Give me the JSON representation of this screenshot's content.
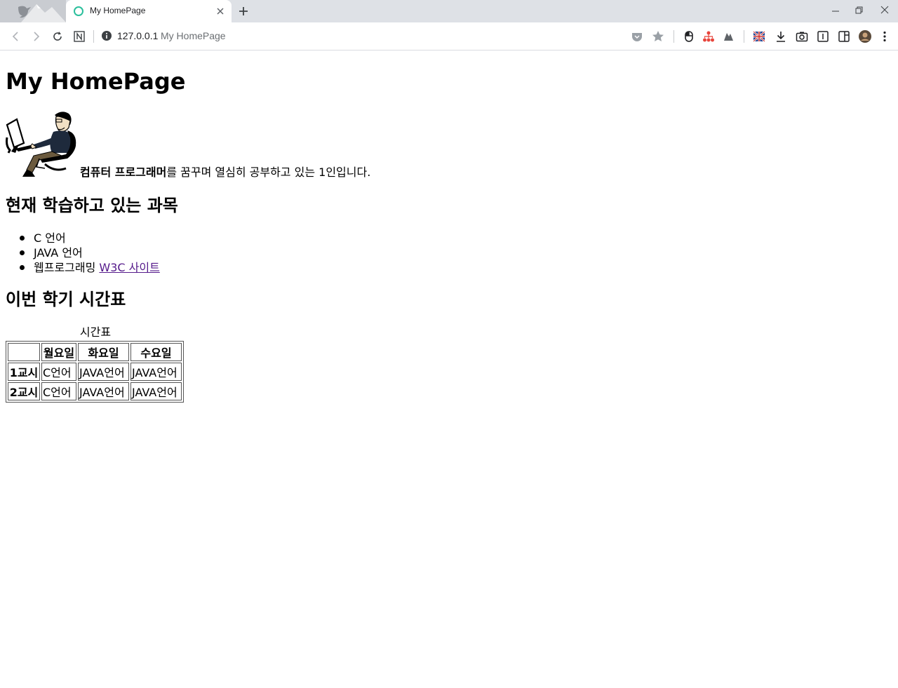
{
  "browser": {
    "tab_title": "My HomePage",
    "url_host": "127.0.0.1",
    "url_title": "My HomePage",
    "accent_favicon": "#2bbf9c"
  },
  "page": {
    "heading": "My HomePage",
    "intro_bold": "컴퓨터 프로그래머",
    "intro_rest": "를 꿈꾸며 열심히 공부하고 있는 1인입니다.",
    "courses_heading": "현재 학습하고 있는 과목",
    "courses": [
      {
        "text": "C 언어"
      },
      {
        "text": "JAVA 언어"
      },
      {
        "text": "웹프로그래밍 ",
        "link": "W3C 사이트"
      }
    ],
    "timetable_heading": "이번 학기 시간표",
    "timetable": {
      "caption": "시간표",
      "headers": [
        "",
        "월요일",
        "화요일",
        "수요일"
      ],
      "rows": [
        {
          "label": "1교시",
          "cells": [
            "C언어",
            "JAVA언어",
            "JAVA언어"
          ]
        },
        {
          "label": "2교시",
          "cells": [
            "C언어",
            "JAVA언어",
            "JAVA언어"
          ]
        }
      ]
    }
  }
}
